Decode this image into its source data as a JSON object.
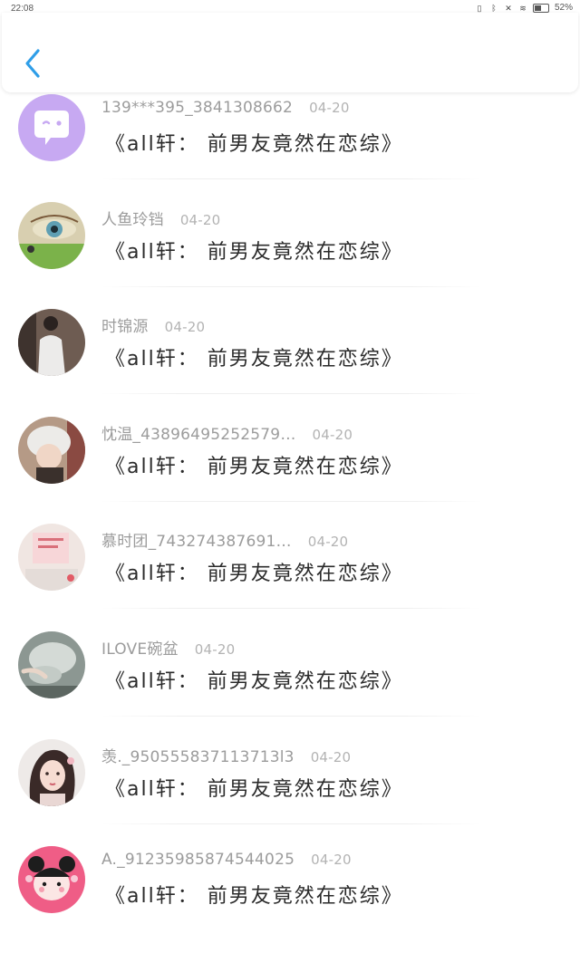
{
  "status_bar": {
    "time": "22:08",
    "battery_level": 0.52,
    "battery_text": "52%",
    "icons": [
      "vibrate-icon",
      "bluetooth-icon",
      "mute-icon",
      "wifi-icon",
      "battery-icon"
    ]
  },
  "header": {
    "back_icon": "chevron-left-icon",
    "accent_color": "#2f9ee8"
  },
  "comments": [
    {
      "username": "139***395_3841308662",
      "date": "04-20",
      "text": "《all轩： 前男友竟然在恋综》",
      "avatar": "default-chat-avatar"
    },
    {
      "username": "人鱼玲铛",
      "date": "04-20",
      "text": "《all轩： 前男友竟然在恋综》",
      "avatar": "eye-closeup-avatar"
    },
    {
      "username": "时锦源",
      "date": "04-20",
      "text": "《all轩： 前男友竟然在恋综》",
      "avatar": "person-standing-avatar"
    },
    {
      "username": "忱温_43896495252579…",
      "date": "04-20",
      "text": "《all轩： 前男友竟然在恋综》",
      "avatar": "girl-hat-avatar"
    },
    {
      "username": "慕时团_743274387691…",
      "date": "04-20",
      "text": "《all轩： 前男友竟然在恋综》",
      "avatar": "pink-note-avatar"
    },
    {
      "username": "ILOVE碗盆",
      "date": "04-20",
      "text": "《all轩： 前男友竟然在恋综》",
      "avatar": "misty-hand-avatar"
    },
    {
      "username": "羡._950555837113713l3",
      "date": "04-20",
      "text": "《all轩： 前男友竟然在恋综》",
      "avatar": "illustrated-girl-avatar"
    },
    {
      "username": "A._91235985874544025",
      "date": "04-20",
      "text": "《all轩： 前男友竟然在恋综》",
      "avatar": "pink-cartoon-avatar"
    }
  ]
}
